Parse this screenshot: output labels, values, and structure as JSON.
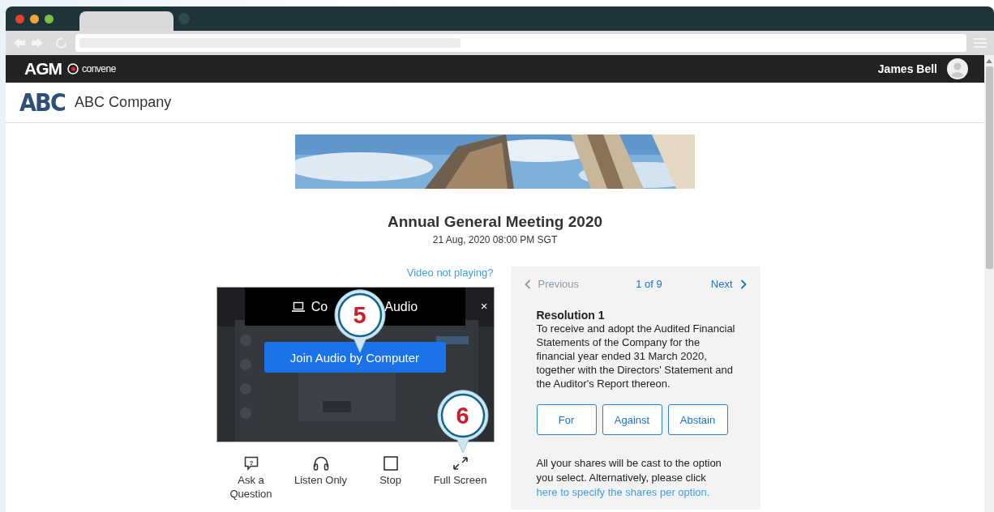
{
  "app_header": {
    "logo": "AGM",
    "brand": "convene",
    "user": "James Bell"
  },
  "company": {
    "logo": "ABC",
    "name": "ABC Company"
  },
  "event": {
    "title": "Annual General Meeting 2020",
    "datetime": "21 Aug, 2020 08:00 PM SGT"
  },
  "video": {
    "help_link": "Video not playing?",
    "dialog": {
      "title_parts": [
        "Co",
        "Audio"
      ],
      "close": "×",
      "join_button": "Join Audio by Computer"
    }
  },
  "controls": [
    {
      "label": "Ask a Question",
      "kind": "question",
      "icon_glyph": "?"
    },
    {
      "label": "Listen Only",
      "kind": "headphones"
    },
    {
      "label": "Stop",
      "kind": "stop"
    },
    {
      "label": "Full Screen",
      "kind": "fullscreen"
    }
  ],
  "callouts": [
    {
      "number": "5"
    },
    {
      "number": "6"
    }
  ],
  "resolution_panel": {
    "previous": {
      "label": "Previous",
      "disabled": true
    },
    "counter": "1 of 9",
    "next": {
      "label": "Next",
      "disabled": false
    },
    "title": "Resolution 1",
    "text": "To receive and adopt the Audited Financial Statements of the Company for the financial year ended 31 March 2020, together with the Directors' Statement and the Auditor's Report thereon.",
    "vote_options": [
      {
        "label": "For",
        "selected": false
      },
      {
        "label": "Against",
        "selected": false
      },
      {
        "label": "Abstain",
        "selected": false
      }
    ],
    "note": "All your shares will be cast to the option you select. Alternatively, please click",
    "link": "here to specify the shares per option."
  }
}
